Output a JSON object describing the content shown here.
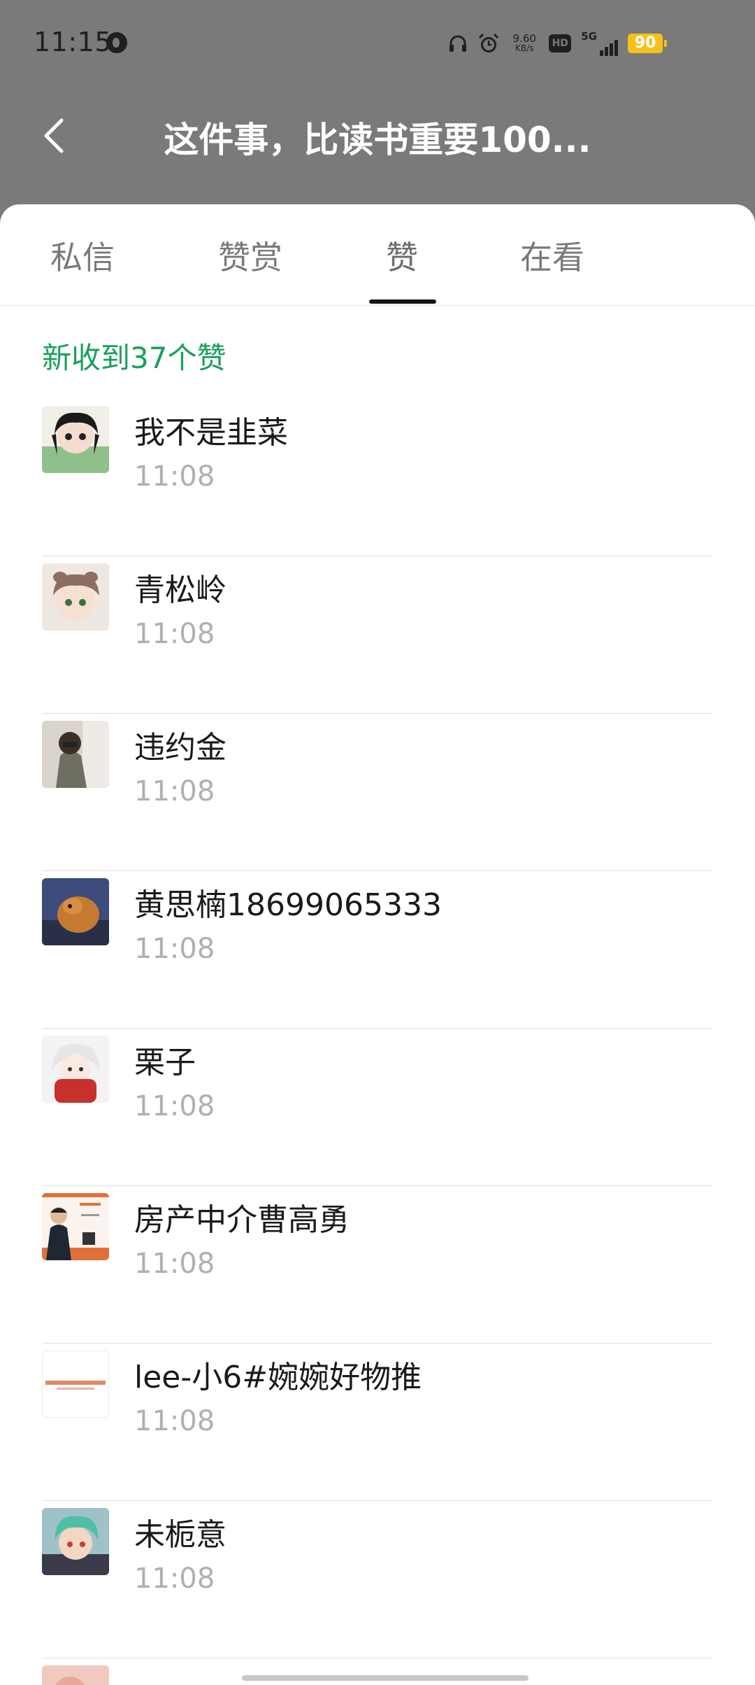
{
  "status_bar": {
    "time": "11:15",
    "network_speed_value": "9.60",
    "network_speed_unit": "KB/s",
    "hd_label": "HD",
    "signal_label": "5G",
    "battery_level": "90",
    "battery_color": "#f4c11c"
  },
  "nav": {
    "title": "这件事，比读书重要100..."
  },
  "tabs": [
    {
      "label": "私信"
    },
    {
      "label": "赞赏"
    },
    {
      "label": "赞"
    },
    {
      "label": "在看"
    }
  ],
  "active_tab": "赞",
  "new_likes_text": "新收到37个赞",
  "accent_color": "#1aa05c",
  "likes": [
    {
      "name": "我不是韭菜",
      "time": "11:08"
    },
    {
      "name": "青松岭",
      "time": "11:08"
    },
    {
      "name": "违约金",
      "time": "11:08"
    },
    {
      "name": "黄思楠18699065333",
      "time": "11:08"
    },
    {
      "name": "栗子",
      "time": "11:08"
    },
    {
      "name": "房产中介曹高勇",
      "time": "11:08"
    },
    {
      "name": "lee-小6#婉婉好物推",
      "time": "11:08"
    },
    {
      "name": "未栀意",
      "time": "11:08"
    }
  ]
}
